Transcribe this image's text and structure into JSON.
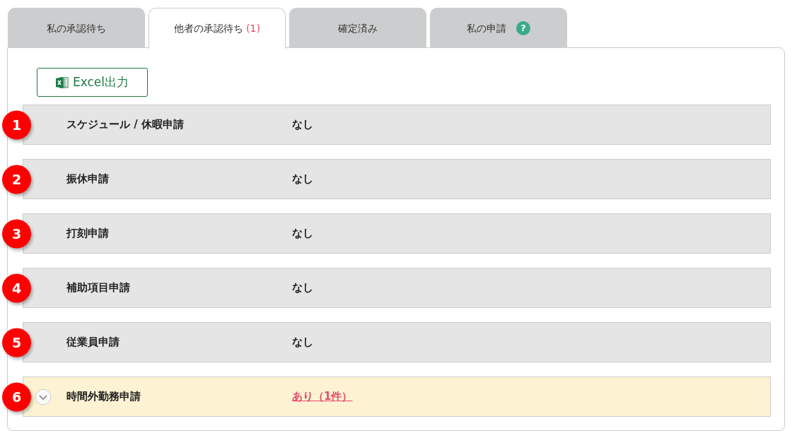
{
  "tabs": [
    {
      "label": "私の承認待ち",
      "selected": false
    },
    {
      "label": "他者の承認待ち",
      "count": "(1)",
      "selected": true
    },
    {
      "label": "確定済み",
      "selected": false
    },
    {
      "label": "私の申請",
      "help": "?",
      "selected": false
    }
  ],
  "export_button": {
    "label": "Excel出力"
  },
  "requests": [
    {
      "number": "1",
      "label": "スケジュール / 休暇申請",
      "status": "なし",
      "kind": "none"
    },
    {
      "number": "2",
      "label": "振休申請",
      "status": "なし",
      "kind": "none"
    },
    {
      "number": "3",
      "label": "打刻申請",
      "status": "なし",
      "kind": "none"
    },
    {
      "number": "4",
      "label": "補助項目申請",
      "status": "なし",
      "kind": "none"
    },
    {
      "number": "5",
      "label": "従業員申請",
      "status": "なし",
      "kind": "none"
    },
    {
      "number": "6",
      "label": "時間外勤務申請",
      "status": "あり（1件）",
      "kind": "pending"
    }
  ]
}
